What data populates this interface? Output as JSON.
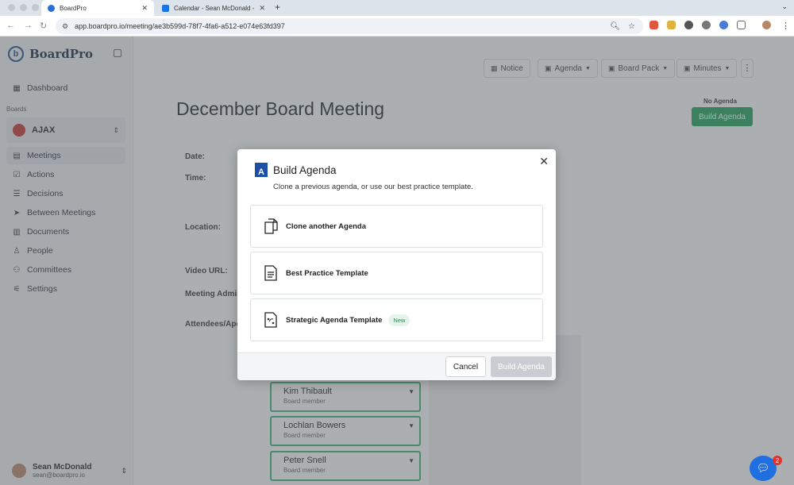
{
  "browser": {
    "tabs": [
      {
        "title": "BoardPro",
        "favicon_color": "#2b6fd6"
      },
      {
        "title": "Calendar - Sean McDonald - ",
        "favicon_color": "#1a73e8"
      }
    ],
    "url": "app.boardpro.io/meeting/ae3b599d-78f7-4fa6-a512-e074e63fd397",
    "extensions": [
      "#e0563f",
      "#e0b33f",
      "#555555",
      "#777777",
      "#4a7bd6",
      "#888888"
    ]
  },
  "sidebar": {
    "brand": "BoardPro",
    "dashboard": "Dashboard",
    "boards_label": "Boards",
    "board_name": "AJAX",
    "items": [
      {
        "label": "Meetings",
        "icon": "calendar-icon"
      },
      {
        "label": "Actions",
        "icon": "clipboard-icon"
      },
      {
        "label": "Decisions",
        "icon": "list-icon"
      },
      {
        "label": "Between Meetings",
        "icon": "send-icon"
      },
      {
        "label": "Documents",
        "icon": "books-icon"
      },
      {
        "label": "People",
        "icon": "person-icon"
      },
      {
        "label": "Committees",
        "icon": "committee-icon"
      },
      {
        "label": "Settings",
        "icon": "sliders-icon"
      }
    ],
    "user": {
      "name": "Sean McDonald",
      "email": "sean@boardpro.io"
    }
  },
  "main": {
    "toolbar": {
      "notice": "Notice",
      "agenda": "Agenda",
      "board_pack": "Board Pack",
      "minutes": "Minutes"
    },
    "title": "December Board Meeting",
    "no_agenda": "No Agenda",
    "build_agenda": "Build Agenda",
    "fields": [
      "Date:",
      "Time:",
      "Location:",
      "Video URL:",
      "Meeting Admini",
      "Attendees/Apol"
    ],
    "members": [
      {
        "name": "Kim Thibault",
        "role": "Board member"
      },
      {
        "name": "Lochlan Bowers",
        "role": "Board member"
      },
      {
        "name": "Peter Snell",
        "role": "Board member"
      }
    ]
  },
  "modal": {
    "title": "Build Agenda",
    "subtitle": "Clone a previous agenda, or use our best practice template.",
    "options": [
      {
        "label": "Clone another Agenda",
        "icon": "clone-document-icon"
      },
      {
        "label": "Best Practice Template",
        "icon": "document-lines-icon"
      },
      {
        "label": "Strategic Agenda Template",
        "icon": "strategy-document-icon",
        "badge": "New"
      }
    ],
    "cancel": "Cancel",
    "confirm": "Build Agenda"
  },
  "chat": {
    "badge": "2"
  }
}
